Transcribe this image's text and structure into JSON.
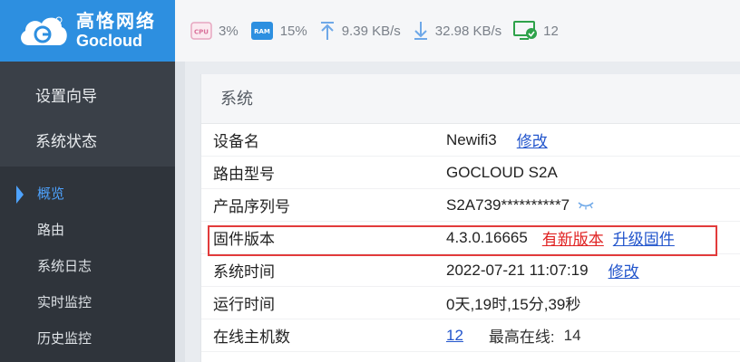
{
  "brand": {
    "name_cn": "高恪网络",
    "name_en": "Gocloud",
    "color": "#2d8fe0"
  },
  "status": {
    "cpu_label": "CPU",
    "cpu": "3%",
    "ram_label": "RAM",
    "ram": "15%",
    "upload": "9.39 KB/s",
    "download": "32.98 KB/s",
    "hosts": "12"
  },
  "sidebar": {
    "main_items": [
      {
        "label": "设置向导"
      },
      {
        "label": "系统状态"
      }
    ],
    "sub_items": [
      {
        "label": "概览",
        "active": true
      },
      {
        "label": "路由"
      },
      {
        "label": "系统日志"
      },
      {
        "label": "实时监控"
      },
      {
        "label": "历史监控"
      }
    ]
  },
  "system": {
    "title": "系统",
    "rows": [
      {
        "label": "设备名",
        "value": "Newifi3",
        "action": "修改"
      },
      {
        "label": "路由型号",
        "value": "GOCLOUD S2A"
      },
      {
        "label": "产品序列号",
        "value": "S2A739**********7"
      },
      {
        "label": "固件版本",
        "value": "4.3.0.16665",
        "new_version": "有新版本",
        "upgrade": "升级固件"
      },
      {
        "label": "系统时间",
        "value": "2022-07-21 11:07:19",
        "action": "修改"
      },
      {
        "label": "运行时间",
        "value": "0天,19时,15分,39秒"
      },
      {
        "label": "在线主机数",
        "value": "12",
        "peak_label": "最高在线:",
        "peak_value": "14"
      }
    ]
  },
  "colors": {
    "accent": "#2d8fe0",
    "highlight_border": "#e23b3b",
    "link": "#2255cc",
    "link_alert": "#e02222"
  }
}
